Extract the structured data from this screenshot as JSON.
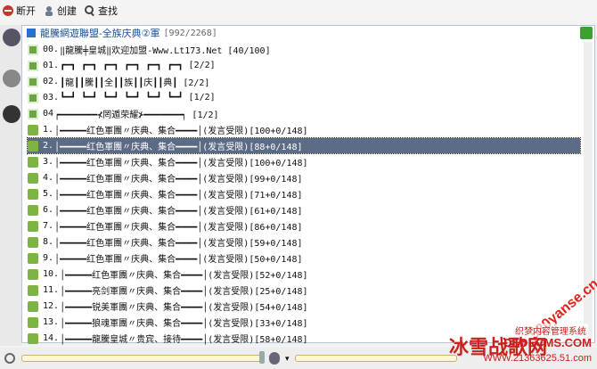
{
  "toolbar": {
    "disconnect_label": "断开",
    "create_label": "创建",
    "find_label": "查找"
  },
  "channel": {
    "title": "龍騰網遊聯盟-全族庆典②軍",
    "count": "[992/2268]"
  },
  "rows": [
    {
      "num": "00.",
      "text": "‖龍騰╪皇城‖欢迎加盟-Www.Lt173.Net [40/100]",
      "icon": "lock"
    },
    {
      "num": "01.",
      "text": "┏━┓ ┏━┓ ┏━┓ ┏━┓ ┏━┓ ┏━┓ [2/2]",
      "icon": "lock"
    },
    {
      "num": "02.",
      "text": "┃龍┃┃騰┃┃全┃┃族┃┃庆┃┃典┃ [2/2]",
      "icon": "lock"
    },
    {
      "num": "03.",
      "text": "┗━┛ ┗━┛ ┗━┛ ┗━┛ ┗━┛ ┗━┛ [1/2]",
      "icon": "lock"
    },
    {
      "num": "04",
      "text": "┍━━━━━━━⊀罔遁荣耀⊁━━━━━━━┑ [1/2]",
      "icon": "lock"
    },
    {
      "num": "1.",
      "text": "│━━━━━红色軍團〃庆典、集合━━━━│(发言受限)[100+0/148]",
      "icon": "plus"
    },
    {
      "num": "2.",
      "text": "│━━━━━红色軍團〃庆典、集合━━━━│(发言受限)[88+0/148]",
      "icon": "plus",
      "selected": true
    },
    {
      "num": "3.",
      "text": "│━━━━━红色軍團〃庆典、集合━━━━│(发言受限)[100+0/148]",
      "icon": "plus"
    },
    {
      "num": "4.",
      "text": "│━━━━━红色軍團〃庆典、集合━━━━│(发言受限)[99+0/148]",
      "icon": "plus"
    },
    {
      "num": "5.",
      "text": "│━━━━━红色軍團〃庆典、集合━━━━│(发言受限)[71+0/148]",
      "icon": "plus"
    },
    {
      "num": "6.",
      "text": "│━━━━━红色軍團〃庆典、集合━━━━│(发言受限)[61+0/148]",
      "icon": "plus"
    },
    {
      "num": "7.",
      "text": "│━━━━━红色軍團〃庆典、集合━━━━│(发言受限)[86+0/148]",
      "icon": "plus"
    },
    {
      "num": "8.",
      "text": "│━━━━━红色軍團〃庆典、集合━━━━│(发言受限)[59+0/148]",
      "icon": "plus"
    },
    {
      "num": "9.",
      "text": "│━━━━━红色軍團〃庆典、集合━━━━│(发言受限)[50+0/148]",
      "icon": "plus"
    },
    {
      "num": "10.",
      "text": "│━━━━━红色軍團〃庆典、集合━━━━│(发言受限)[52+0/148]",
      "icon": "plus"
    },
    {
      "num": "11.",
      "text": "│━━━━━亮剑軍團〃庆典、集合━━━━│(发言受限)[25+0/148]",
      "icon": "plus"
    },
    {
      "num": "12.",
      "text": "│━━━━━锐美軍團〃庆典、集合━━━━│(发言受限)[54+0/148]",
      "icon": "plus"
    },
    {
      "num": "13.",
      "text": "│━━━━━狼魂軍團〃庆典、集合━━━━│(发言受限)[33+0/148]",
      "icon": "plus"
    },
    {
      "num": "14.",
      "text": "│━━━━━龍騰皇城〃贵宾、接待━━━━│(发言受限)[58+0/148]",
      "icon": "plus"
    }
  ],
  "watermark": {
    "brand": "冰雪战歌网",
    "domain_top": "520yanse.cn",
    "cms": "织梦内容管理系统",
    "dedecms": "DEDECMS.COM",
    "bottom": "WWW.21363625.51.com"
  },
  "colors": {
    "selected_bg": "#5b6b86",
    "title_blue": "#1a4f9a",
    "watermark_red": "#c8211e"
  }
}
